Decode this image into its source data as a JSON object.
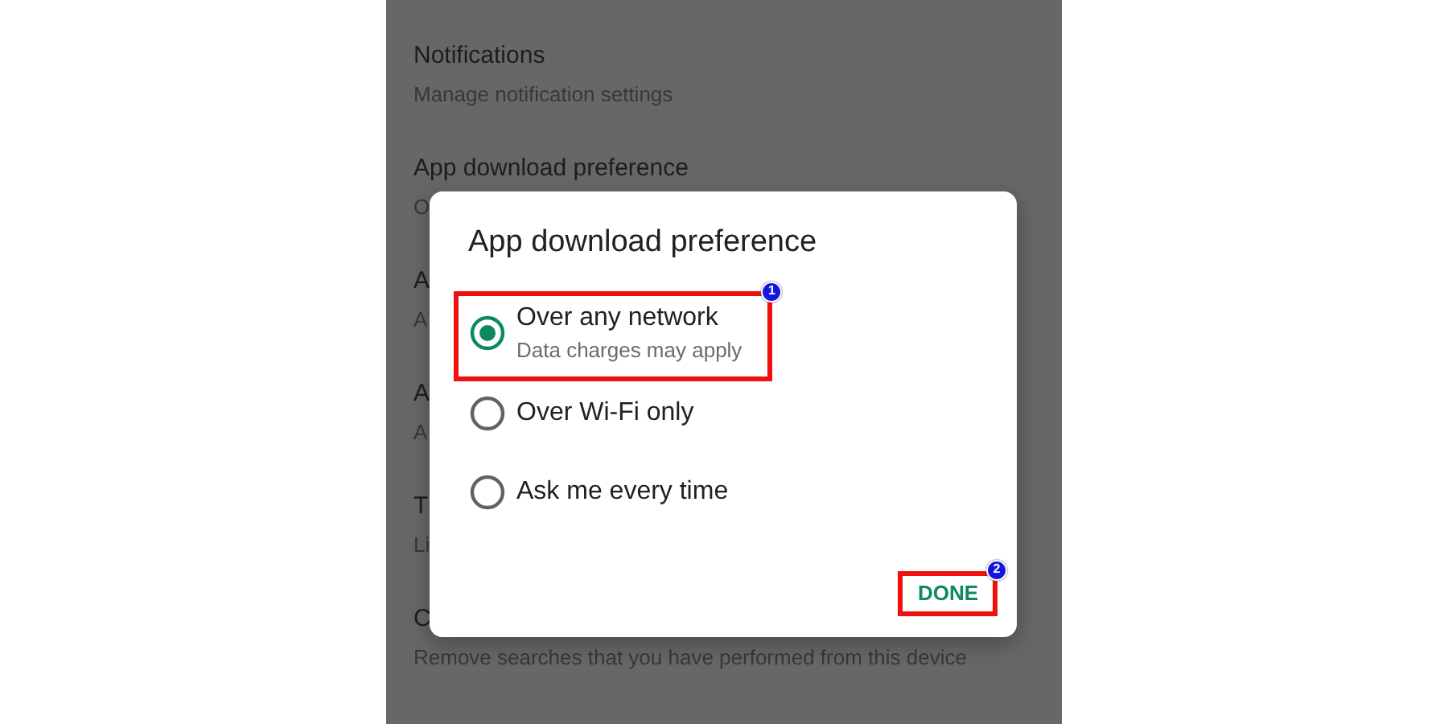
{
  "settings_list": [
    {
      "title": "Notifications",
      "subtitle": "Manage notification settings"
    },
    {
      "title": "App download preference",
      "subtitle": "O"
    },
    {
      "title": "A",
      "subtitle": "A"
    },
    {
      "title": "A",
      "subtitle": "A"
    },
    {
      "title": "T",
      "subtitle": "Li"
    },
    {
      "title": "C",
      "subtitle": "Remove searches that you have performed from this device"
    }
  ],
  "dialog": {
    "title": "App download preference",
    "options": [
      {
        "label": "Over any network",
        "description": "Data charges may apply",
        "selected": true,
        "highlighted": true,
        "step": "1"
      },
      {
        "label": "Over Wi-Fi only",
        "selected": false,
        "highlighted": false
      },
      {
        "label": "Ask me every time",
        "selected": false,
        "highlighted": false
      }
    ],
    "button": {
      "label": "DONE",
      "highlighted": true,
      "step": "2"
    }
  }
}
